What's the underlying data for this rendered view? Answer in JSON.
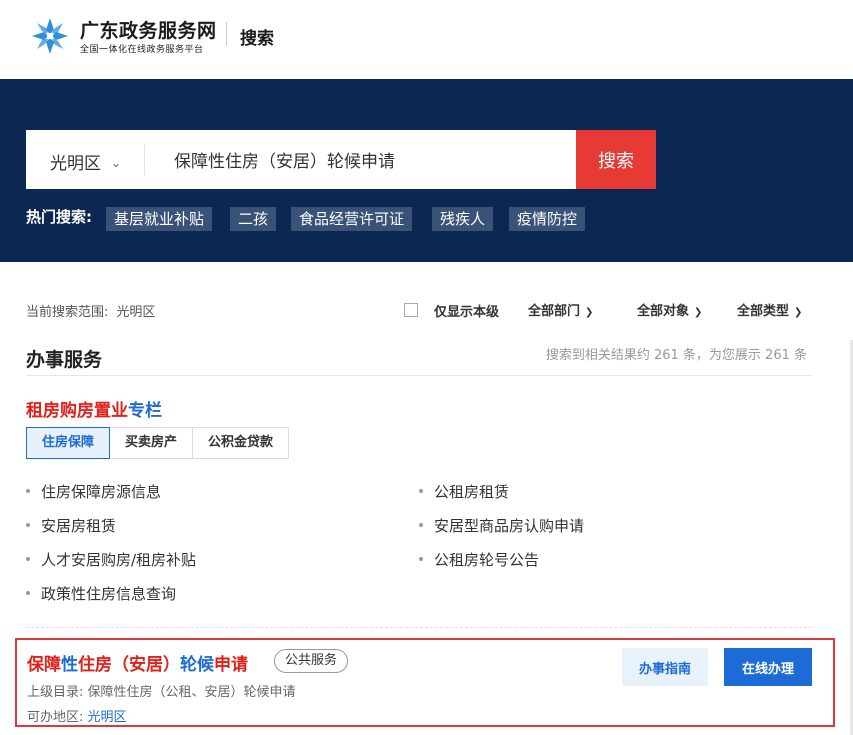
{
  "header": {
    "logo_title": "广东政务服务网",
    "logo_subtitle": "全国一体化在线政务服务平台",
    "page_name": "搜索"
  },
  "search": {
    "region": "光明区",
    "query": "保障性住房（安居）轮候申请",
    "button_label": "搜索"
  },
  "hot_search": {
    "label": "热门搜索:",
    "tags": [
      "基层就业补贴",
      "二孩",
      "食品经营许可证",
      "残疾人",
      "疫情防控"
    ]
  },
  "filters": {
    "scope_label": "当前搜索范围:",
    "scope_value": "光明区",
    "only_this_level_label": "仅显示本级",
    "only_this_level_checked": false,
    "dept": "全部部门",
    "target": "全部对象",
    "type": "全部类型"
  },
  "section": {
    "title": "办事服务",
    "result_count": "搜索到相关结果约 261 条，为您展示 261 条"
  },
  "column": {
    "title_red": "租房购房置业",
    "title_blue": "专栏",
    "tabs": [
      "住房保障",
      "买卖房产",
      "公积金贷款"
    ],
    "active_tab": "住房保障",
    "links": [
      "住房保障房源信息",
      "公租房租赁",
      "安居房租赁",
      "安居型商品房认购申请",
      "人才安居购房/租房补贴",
      "公租房轮号公告",
      "政策性住房信息查询"
    ]
  },
  "result": {
    "title_parts": [
      "保障",
      "性",
      "住房（安居）",
      "轮候",
      "申请"
    ],
    "badge": "公共服务",
    "parent_label": "上级目录:",
    "parent_value": "保障性住房（公租、安居）轮候申请",
    "area_label": "可办地区:",
    "area_value": "光明区",
    "guide_button": "办事指南",
    "online_button": "在线办理"
  },
  "colors": {
    "hero_bg": "#0c2751",
    "accent_red": "#e83a35",
    "link_blue": "#1c6bd6",
    "logo_blue": "#2f8fdc"
  }
}
